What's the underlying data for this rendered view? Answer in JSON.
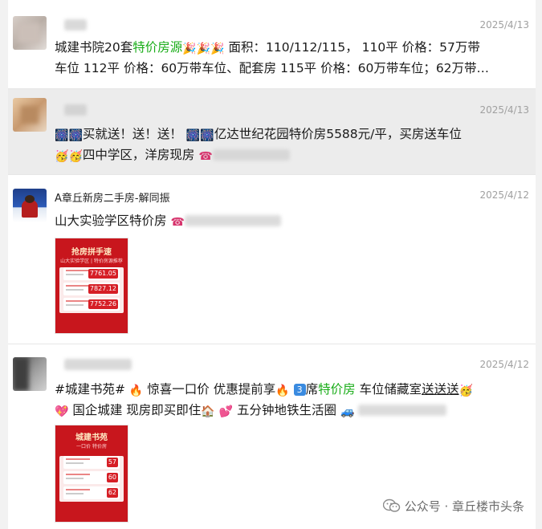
{
  "posts": [
    {
      "author": "",
      "date": "2025/4/13",
      "line1": {
        "a": "城建书院20套",
        "green": "特价房源",
        "b": " 面积：110/112/115， 110平 价格：57万带"
      },
      "line2": "车位 112平 价格：60万带车位、配套房 115平 价格：60万带车位；62万带…"
    },
    {
      "author": "",
      "date": "2025/4/13",
      "line1": {
        "a": "买就送！送！送！",
        "b": "亿达世纪花园特价房5588元/平，买房送车位"
      },
      "line2": "四中学区，洋房现房"
    },
    {
      "author": "A章丘新房二手房-解同振",
      "date": "2025/4/12",
      "line1": "山大实验学区特价房",
      "poster": {
        "title": "抢房拼手速",
        "sub": "山大实验学区 | 特价房源推荐",
        "prices": [
          "7761.05",
          "7827.12",
          "7752.26"
        ]
      }
    },
    {
      "author": "",
      "date": "2025/4/12",
      "line1": {
        "a": "#城建书苑#",
        "b": " 惊喜一口价 优惠提前享",
        "badge": "3",
        "c": "席",
        "green": "特价房",
        "d": " 车位储藏室",
        "e": "送送送"
      },
      "line2": {
        "a": " 国企城建 现房即买即住",
        "b": " 五分钟地铁生活圈"
      },
      "poster": {
        "title": "城建书苑",
        "sub": "一口价 特价房",
        "prices": [
          "57",
          "60",
          "62"
        ]
      }
    }
  ],
  "watermark": "公众号 · 章丘楼市头条",
  "colors": {
    "accent_green": "#1aad19",
    "highlight_bg": "#ececec",
    "date_gray": "#a0a0a0",
    "poster_red": "#c8161d"
  }
}
